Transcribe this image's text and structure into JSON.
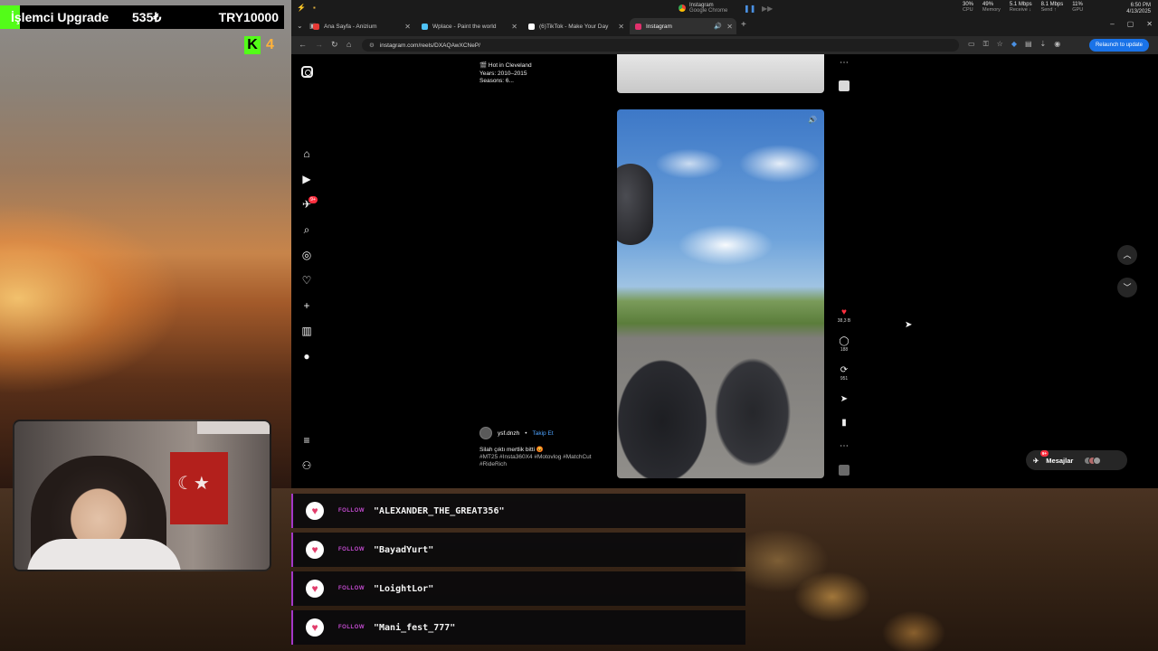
{
  "overlay": {
    "goal_label": "İşlemci Upgrade",
    "goal_current": "535₺",
    "goal_target": "TRY10000",
    "goal_progress": 0.0535,
    "kick_logo": "K",
    "kick_count": "4",
    "accent": "#53fc18"
  },
  "system": {
    "chrome_title": "Instagram",
    "chrome_sub": "Google Chrome",
    "cpu_value": "30%",
    "cpu_label": "CPU",
    "mem_value": "49%",
    "mem_label": "Memory",
    "recv_value": "5.1 Mbps",
    "recv_label": "Receive ↓",
    "send_value": "8.1 Mbps",
    "send_label": "Send ↑",
    "gpu_value": "11%",
    "gpu_label": "GPU",
    "time": "6:50 PM",
    "date": "4/13/2025"
  },
  "tabs": [
    {
      "label": "Ana Sayfa - Anizium",
      "color": "#e53935"
    },
    {
      "label": "Wplace - Paint the world",
      "color": "#4fc3f7"
    },
    {
      "label": "(6)TikTok - Make Your Day",
      "color": "#ffffff"
    },
    {
      "label": "Instagram",
      "color": "#e1306c"
    }
  ],
  "address": {
    "url": "instagram.com/reels/DXAQAwXCNeP/",
    "relaunch": "Relaunch to update"
  },
  "previous_reel": {
    "title": "🎬 Hot in Cleveland",
    "years": "Years: 2010–2015",
    "seasons": "Seasons: 6..."
  },
  "reel": {
    "author": "ysf.dnzh",
    "separator": "•",
    "follow": "Takip Et",
    "caption": "Silah çıktı mertlik bitti 😡",
    "tags_line1": "#MT25 #Insta360X4 #Motovlog #MatchCut",
    "tags_line2": "#RideRich"
  },
  "actions": {
    "likes": "38,3 B",
    "comments": "188",
    "reposts": "951"
  },
  "messages": {
    "label": "Mesajlar",
    "badge": "9+"
  },
  "sidebar": {
    "notif_badge": "9+"
  },
  "follow_alerts": {
    "tag": "FOLLOW",
    "names": [
      "\"ALEXANDER_THE_GREAT356\"",
      "\"BayadYurt\"",
      "\"LoightLor\"",
      "\"Mani_fest_777\""
    ]
  }
}
